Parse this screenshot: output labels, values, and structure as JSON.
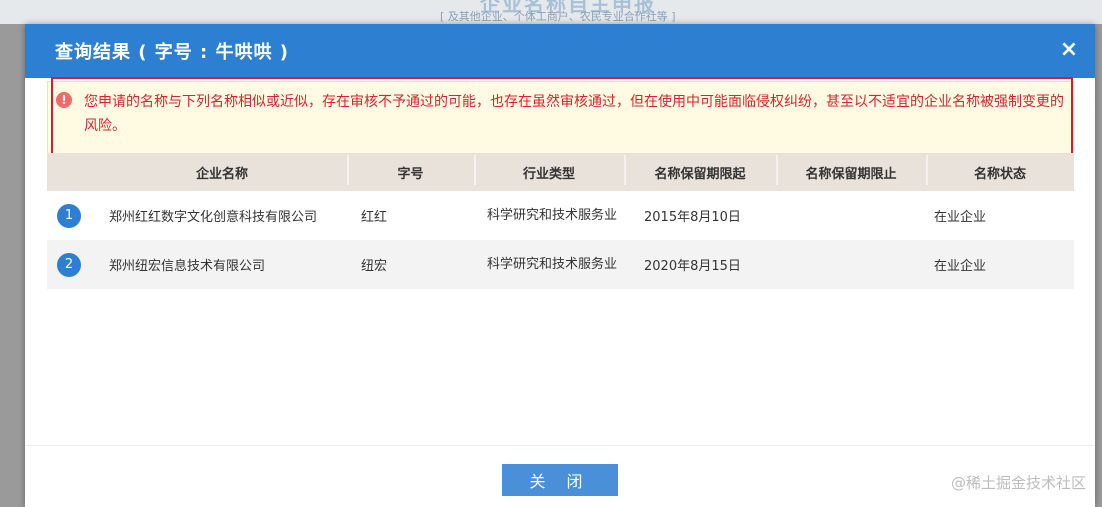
{
  "background": {
    "title": "企业名称自主申报",
    "subtitle": "[ 及其他企业、个体工商户、农民专业合作社等 ]"
  },
  "modal": {
    "title": "查询结果 ( 字号 : 牛哄哄 )",
    "close_symbol": "×",
    "warning_icon": "!",
    "warning_text": "您申请的名称与下列名称相似或近似，存在审核不予通过的可能，也存在虽然审核通过，但在使用中可能面临侵权纠纷，甚至以不适宜的企业名称被强制变更的风险。",
    "close_button_label": "关 闭"
  },
  "table": {
    "headers": [
      "企业名称",
      "字号",
      "行业类型",
      "名称保留期限起",
      "名称保留期限止",
      "名称状态"
    ],
    "rows": [
      {
        "num": "1",
        "name": "郑州红红数字文化创意科技有限公司",
        "word": "红红",
        "industry": "科学研究和技术服务业",
        "start": "2015年8月10日",
        "end": "",
        "status": "在业企业"
      },
      {
        "num": "2",
        "name": "郑州纽宏信息技术有限公司",
        "word": "纽宏",
        "industry": "科学研究和技术服务业",
        "start": "2020年8月15日",
        "end": "",
        "status": "在业企业"
      }
    ]
  },
  "watermark": "@稀土掘金技术社区",
  "colors": {
    "header_blue": "#2c7fd1",
    "warning_red": "#d9232f",
    "button_blue": "#4a90d9"
  }
}
